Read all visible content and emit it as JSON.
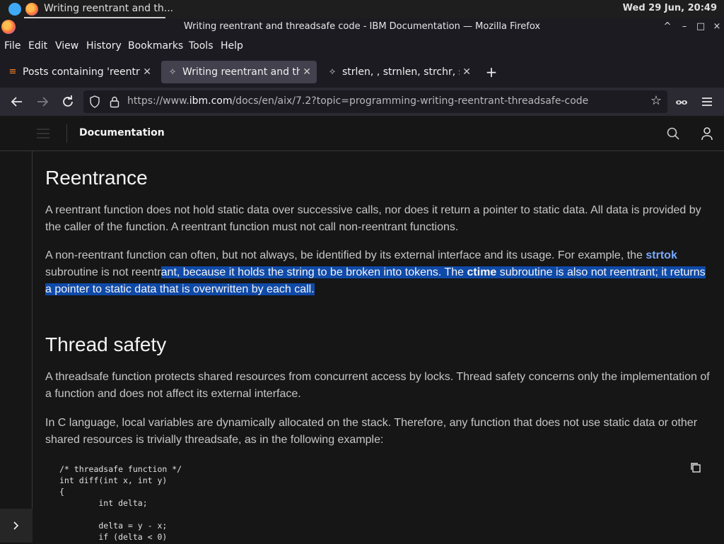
{
  "system": {
    "task_title": "Writing reentrant and th...",
    "clock": "Wed 29 Jun, 20:49"
  },
  "window": {
    "title": "Writing reentrant and threadsafe code - IBM Documentation — Mozilla Firefox",
    "controls": [
      "^",
      "–",
      "□",
      "×"
    ]
  },
  "menu": [
    "File",
    "Edit",
    "View",
    "History",
    "Bookmarks",
    "Tools",
    "Help"
  ],
  "tabs": [
    {
      "label": "Posts containing 'reentra",
      "icon": "stack-icon",
      "active": false
    },
    {
      "label": "Writing reentrant and thr",
      "icon": "ibm-icon",
      "active": true
    },
    {
      "label": "strlen, , strnlen, strchr, st",
      "icon": "ibm-icon",
      "active": false
    }
  ],
  "nav": {
    "url_prefix": "https://www.",
    "url_domain": "ibm.com",
    "url_path": "/docs/en/aix/7.2?topic=programming-writing-reentrant-threadsafe-code"
  },
  "site": {
    "header_title": "Documentation"
  },
  "article": {
    "h_reentrance": "Reentrance",
    "p1": "A reentrant function does not hold static data over successive calls, nor does it return a pointer to static data. All data is provided by the caller of the function. A reentrant function must not call non-reentrant functions.",
    "p2_a": "A non-reentrant function can often, but not always, be identified by its external interface and its usage. For example, the ",
    "p2_link": "strtok",
    "p2_b": " subroutine is not reentr",
    "p2_sel_a": "ant, because it holds the string to be broken into tokens. The ",
    "p2_sel_strong": "ctime",
    "p2_sel_b": " subroutine is also not reentrant; it returns a pointer to static data that is overwritten by each call.",
    "h_thread": "Thread safety",
    "p3": "A threadsafe function protects shared resources from concurrent access by locks. Thread safety concerns only the implementation of a function and does not affect its external interface.",
    "p4": "In C language, local variables are dynamically allocated on the stack. Therefore, any function that does not use static data or other shared resources is trivially threadsafe, as in the following example:",
    "code": "/* threadsafe function */\nint diff(int x, int y)\n{\n        int delta;\n\n        delta = y - x;\n        if (delta < 0)"
  }
}
